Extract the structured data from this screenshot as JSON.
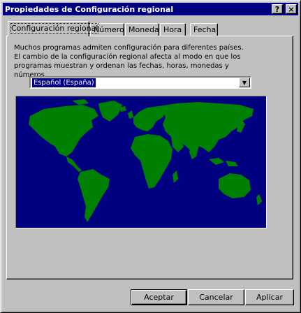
{
  "window": {
    "title": "Propiedades de Configuración regional",
    "help_button": "?",
    "close_button": "×"
  },
  "tabs": [
    {
      "label": "Configuración regional",
      "active": true
    },
    {
      "label": "Número",
      "active": false
    },
    {
      "label": "Moneda",
      "active": false
    },
    {
      "label": "Hora",
      "active": false
    },
    {
      "label": "Fecha",
      "active": false
    }
  ],
  "regional": {
    "description": "Muchos programas admiten configuración para diferentes países. El cambio de la configuración regional afecta al modo en que los programas muestran y ordenan las fechas, horas, monedas y números.",
    "locale_selected": "Español (España)",
    "map_icon": "world-map",
    "colors": {
      "ocean": "#000080",
      "land": "#008000"
    }
  },
  "buttons": {
    "accept": "Aceptar",
    "cancel": "Cancelar",
    "apply": "Aplicar"
  }
}
